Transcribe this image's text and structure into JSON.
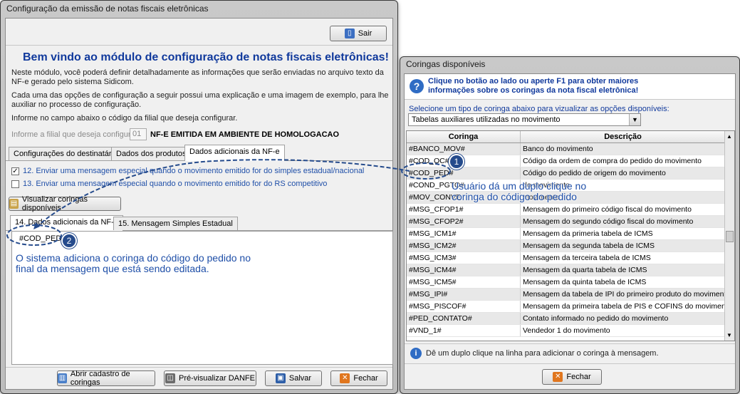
{
  "main": {
    "title": "Configuração da emissão de notas fiscais eletrônicas",
    "exit_label": "Sair",
    "welcome": "Bem vindo ao módulo de configuração de notas fiscais eletrônicas!",
    "p1": "Neste módulo, você poderá definir detalhadamente as informações que serão enviadas no arquivo texto da NF-e gerado pelo sistema Sidicom.",
    "p2": "Cada uma das opções de configuração a seguir possui uma explicação e uma imagem de exemplo, para lhe auxiliar no processo de configuração.",
    "p3": "Informe no campo abaixo o código da filial que deseja configurar.",
    "filial_label": "Informe a filial que deseja configurar:",
    "filial_value": "01",
    "filial_status": "NF-E EMITIDA EM AMBIENTE DE HOMOLOGACAO",
    "tabs": [
      "Configurações do destinatário",
      "Dados dos produtos",
      "Dados adicionais da NF-e"
    ],
    "checks": [
      {
        "checked": "✓",
        "label": "12. Enviar uma mensagem especial quando o movimento emitido for do simples estadual/nacional"
      },
      {
        "checked": "",
        "label": "13. Enviar uma mensagem especial quando o movimento emitido for do RS competitivo"
      }
    ],
    "view_wildcards_label": "Visualizar coringas disponíveis",
    "subtabs": [
      "14. Dados adicionais da NF-e",
      "15. Mensagem Simples Estadual"
    ],
    "editor_text": "#COD_PED#",
    "footer_buttons": [
      "Abrir cadastro de coringas",
      "Pré-visualizar DANFE",
      "Salvar",
      "Fechar"
    ]
  },
  "coringas": {
    "title": "Coringas disponíveis",
    "info": "Clique no botão ao lado ou aperte F1 para obter maiores informações sobre os coringas da nota fiscal eletrônica!",
    "select_label": "Selecione um tipo de coringa abaixo para vizualizar as opções disponíveis:",
    "select_value": "Tabelas auxiliares utilizadas no movimento",
    "headers": [
      "Coringa",
      "Descrição"
    ],
    "rows": [
      [
        "#BANCO_MOV#",
        "Banco do movimento"
      ],
      [
        "#COD_OC#",
        "Código da ordem de compra do pedido do movimento"
      ],
      [
        "#COD_PED#",
        "Código do pedido de origem do movimento"
      ],
      [
        "#COND_PGTO#",
        "do movimento"
      ],
      [
        "#MOV_CONVE",
        "movimento"
      ],
      [
        "#MSG_CFOP1#",
        "Mensagem do primeiro código fiscal do movimento"
      ],
      [
        "#MSG_CFOP2#",
        "Mensagem do segundo código fiscal do movimento"
      ],
      [
        "#MSG_ICM1#",
        "Mensagem da primeria tabela de ICMS"
      ],
      [
        "#MSG_ICM2#",
        "Mensagem da segunda tabela de ICMS"
      ],
      [
        "#MSG_ICM3#",
        "Mensagem da terceira tabela de ICMS"
      ],
      [
        "#MSG_ICM4#",
        "Mensagem da quarta tabela de ICMS"
      ],
      [
        "#MSG_ICM5#",
        "Mensagem da quinta tabela de ICMS"
      ],
      [
        "#MSG_IPI#",
        "Mensagem da tabela de IPI do primeiro produto do movimento"
      ],
      [
        "#MSG_PISCOF#",
        "Mensagem da primeira tabela de PIS e COFINS do movimento"
      ],
      [
        "#PED_CONTATO#",
        "Contato informado no pedido do movimento"
      ],
      [
        "#VND_1#",
        "Vendedor 1 do movimento"
      ]
    ],
    "hint": "Dê um duplo clique na linha para adicionar o coringa à mensagem.",
    "close_label": "Fechar"
  },
  "annotations": {
    "step1_badge": "1",
    "step1_text": "Usuário dá um duplo clique no coringa do código do pedido",
    "step2_badge": "2",
    "step2_text": "O sistema adiciona o coringa do código do pedido no final da mensagem que está sendo editada."
  },
  "colors": {
    "heading": "#10399c",
    "annotation": "#1f4fa8",
    "badge": "#254b8c"
  }
}
